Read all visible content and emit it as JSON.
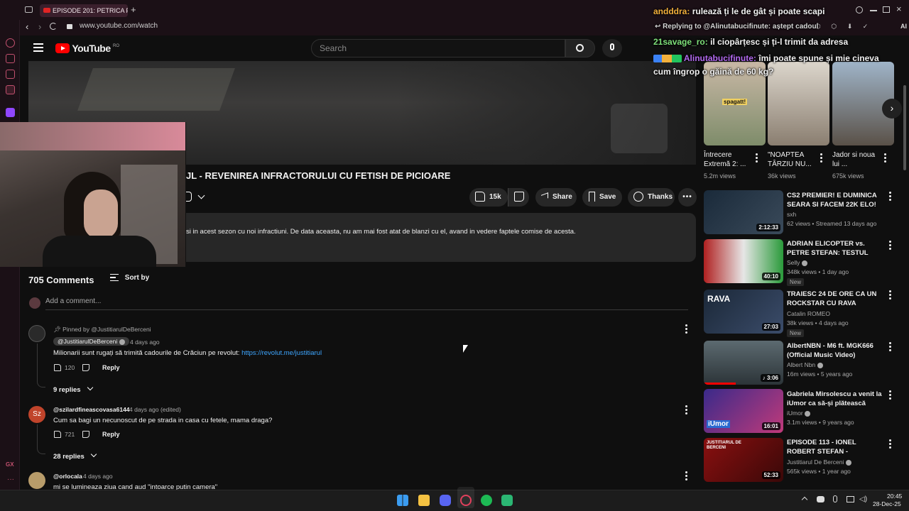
{
  "browser": {
    "tab_title": "EPISODE 201: PETRICA PU",
    "url": "www.youtube.com/watch",
    "new_tab_symbol": "+"
  },
  "youtube": {
    "logo_text": "YouTube",
    "region": "RO",
    "search_placeholder": "Search"
  },
  "video": {
    "title_partial": "JL - REVENIREA INFRACTORULUI CU FETISH DE PICIOARE",
    "like_count": "15k",
    "share_label": "Share",
    "save_label": "Save",
    "thanks_label": "Thanks",
    "description": "si in acest sezon cu noi infractiuni. De data aceasta, nu am mai fost atat de blanzi cu el, avand in vedere faptele comise de acesta."
  },
  "comments": {
    "count_label": "705 Comments",
    "sort_label": "Sort by",
    "add_placeholder": "Add a comment...",
    "items": [
      {
        "pinned_label": "Pinned by @JustitiarulDeBerceni",
        "author": "@JustitiarulDeBerceni",
        "time": "4 days ago",
        "text": "Milionarii sunt rugați să trimită cadourile de Crăciun pe revolut: ",
        "link": "https://revolut.me/justitiarul",
        "likes": "120",
        "reply_label": "Reply",
        "replies_label": "9 replies"
      },
      {
        "avatar_initials": "Sz",
        "author": "@szilardfineascovasa6144",
        "time": "4 days ago (edited)",
        "text": "Cum sa bagi un necunoscut de pe strada in casa cu fetele, mama draga?",
        "likes": "721",
        "reply_label": "Reply",
        "replies_label": "28 replies"
      },
      {
        "author": "@orlocala",
        "time": "4 days ago",
        "text": "mi se lumineaza ziua cand aud \"intoarce putin camera\""
      }
    ]
  },
  "chat_overlay": [
    {
      "user": "andddra:",
      "text": "rulează ți le de gât și poate scapi",
      "user_color": "#f2b03c"
    },
    {
      "user": "",
      "text": "Replying to @Alinutabucifinute: aștept cadoul",
      "user_color": "#cfcfcf"
    },
    {
      "user": "21savage_ro:",
      "text": "il ciopârțesc și ți-l trimit da adresa",
      "user_color": "#7ee07a"
    },
    {
      "user": "Alinutabucifinute:",
      "text": "îmi poate spune și mie cineva",
      "user_color": "#b36af0"
    },
    {
      "user": "",
      "text": "cum îngrop o găină de 60 kg?",
      "user_color": "#ffffff"
    }
  ],
  "shorts": [
    {
      "title": "Întrecere Extremă 2: ...",
      "views": "5.2m views",
      "overlay": "spagatt!"
    },
    {
      "title": "\"NOAPTEA TÂRZIU NU...",
      "views": "36k views"
    },
    {
      "title": "Jador si noua lui ...",
      "views": "675k views"
    }
  ],
  "recommended": [
    {
      "title": "CS2 PREMIER! E DUMINICA SEARA SI FACEM 22K ELO! HA...",
      "channel": "sxh",
      "meta": "62 views • Streamed 13 days ago",
      "duration": "2:12:33",
      "verified": false,
      "is_new": false
    },
    {
      "title": "ADRIAN ELICOPTER vs. PETRE STEFAN: TESTUL POLIGRAF ...",
      "channel": "Selly",
      "meta": "348k views • 1 day ago",
      "duration": "40:10",
      "verified": true,
      "is_new": true
    },
    {
      "title": "TRAIESC 24 DE ORE CA UN ROCKSTAR CU RAVA",
      "channel": "Catalin ROMEO",
      "meta": "38k views • 4 days ago",
      "duration": "27:03",
      "verified": false,
      "is_new": true,
      "thumb_text": "RAVA"
    },
    {
      "title": "AlbertNBN - M6 ft. MGK666 (Official Music Video)",
      "channel": "Albert Nbn",
      "meta": "16m views • 5 years ago",
      "duration": "3:06",
      "verified": true,
      "is_new": false
    },
    {
      "title": "Gabriela Mirsolescu a venit la iUmor ca să-și plătească ratel...",
      "channel": "iUmor",
      "meta": "3.1m views • 9 years ago",
      "duration": "16:01",
      "verified": true,
      "is_new": false,
      "thumb_text": "iUmor"
    },
    {
      "title": "EPISODE 113 - IONEL ROBERT STEFAN - PRIMARUL ...",
      "channel": "Justitiarul De Berceni",
      "meta": "565k views • 1 year ago",
      "duration": "52:33",
      "verified": true,
      "is_new": false,
      "thumb_text": "JUSTITIARUL DE BERCENI"
    }
  ],
  "new_badge": "New",
  "taskbar": {
    "time": "20:45",
    "date": "28-Dec-25"
  },
  "colors": {
    "accent_red": "#ff0000",
    "link": "#3ea6ff",
    "opera_red": "#c2506e"
  }
}
